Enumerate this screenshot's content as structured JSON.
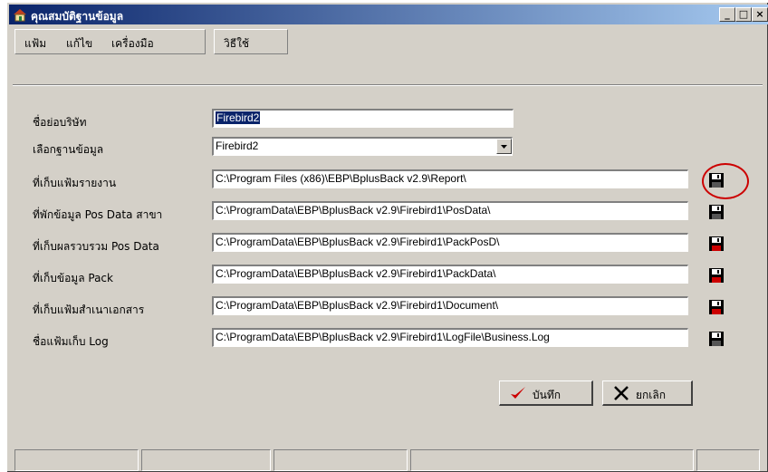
{
  "window": {
    "title": "คุณสมบัติฐานข้อมูล"
  },
  "menu": {
    "file": "แฟ้ม",
    "edit": "แก้ไข",
    "tools": "เครื่องมือ",
    "help": "วิธีใช้"
  },
  "form": {
    "company_label": "ชื่อย่อบริษัท",
    "company_value": "Firebird2",
    "database_label": "เลือกฐานข้อมูล",
    "database_value": "Firebird2",
    "rows": [
      {
        "label": "ที่เก็บแฟ้มรายงาน",
        "value": "C:\\Program Files (x86)\\EBP\\BplusBack v2.9\\Report\\"
      },
      {
        "label": "ที่พักข้อมูล Pos Data สาขา",
        "value": "C:\\ProgramData\\EBP\\BplusBack v2.9\\Firebird1\\PosData\\"
      },
      {
        "label": "ที่เก็บผลรวบรวม Pos Data",
        "value": "C:\\ProgramData\\EBP\\BplusBack v2.9\\Firebird1\\PackPosD\\"
      },
      {
        "label": "ที่เก็บข้อมูล Pack",
        "value": "C:\\ProgramData\\EBP\\BplusBack v2.9\\Firebird1\\PackData\\"
      },
      {
        "label": "ที่เก็บแฟ้มสำเนาเอกสาร",
        "value": "C:\\ProgramData\\EBP\\BplusBack v2.9\\Firebird1\\Document\\"
      },
      {
        "label": "ชื่อแฟ้มเก็บ Log",
        "value": "C:\\ProgramData\\EBP\\BplusBack v2.9\\Firebird1\\LogFile\\Business.Log"
      }
    ]
  },
  "buttons": {
    "save": "บันทึก",
    "cancel": "ยกเลิก"
  },
  "icons": {
    "app": "house-icon",
    "browse": "floppy-disk-icon",
    "save": "checkmark-icon",
    "cancel": "x-icon"
  },
  "colors": {
    "titlebar": "#0a246a",
    "window": "#d4d0c8",
    "highlight": "#cc0000",
    "check": "#cc0000"
  }
}
